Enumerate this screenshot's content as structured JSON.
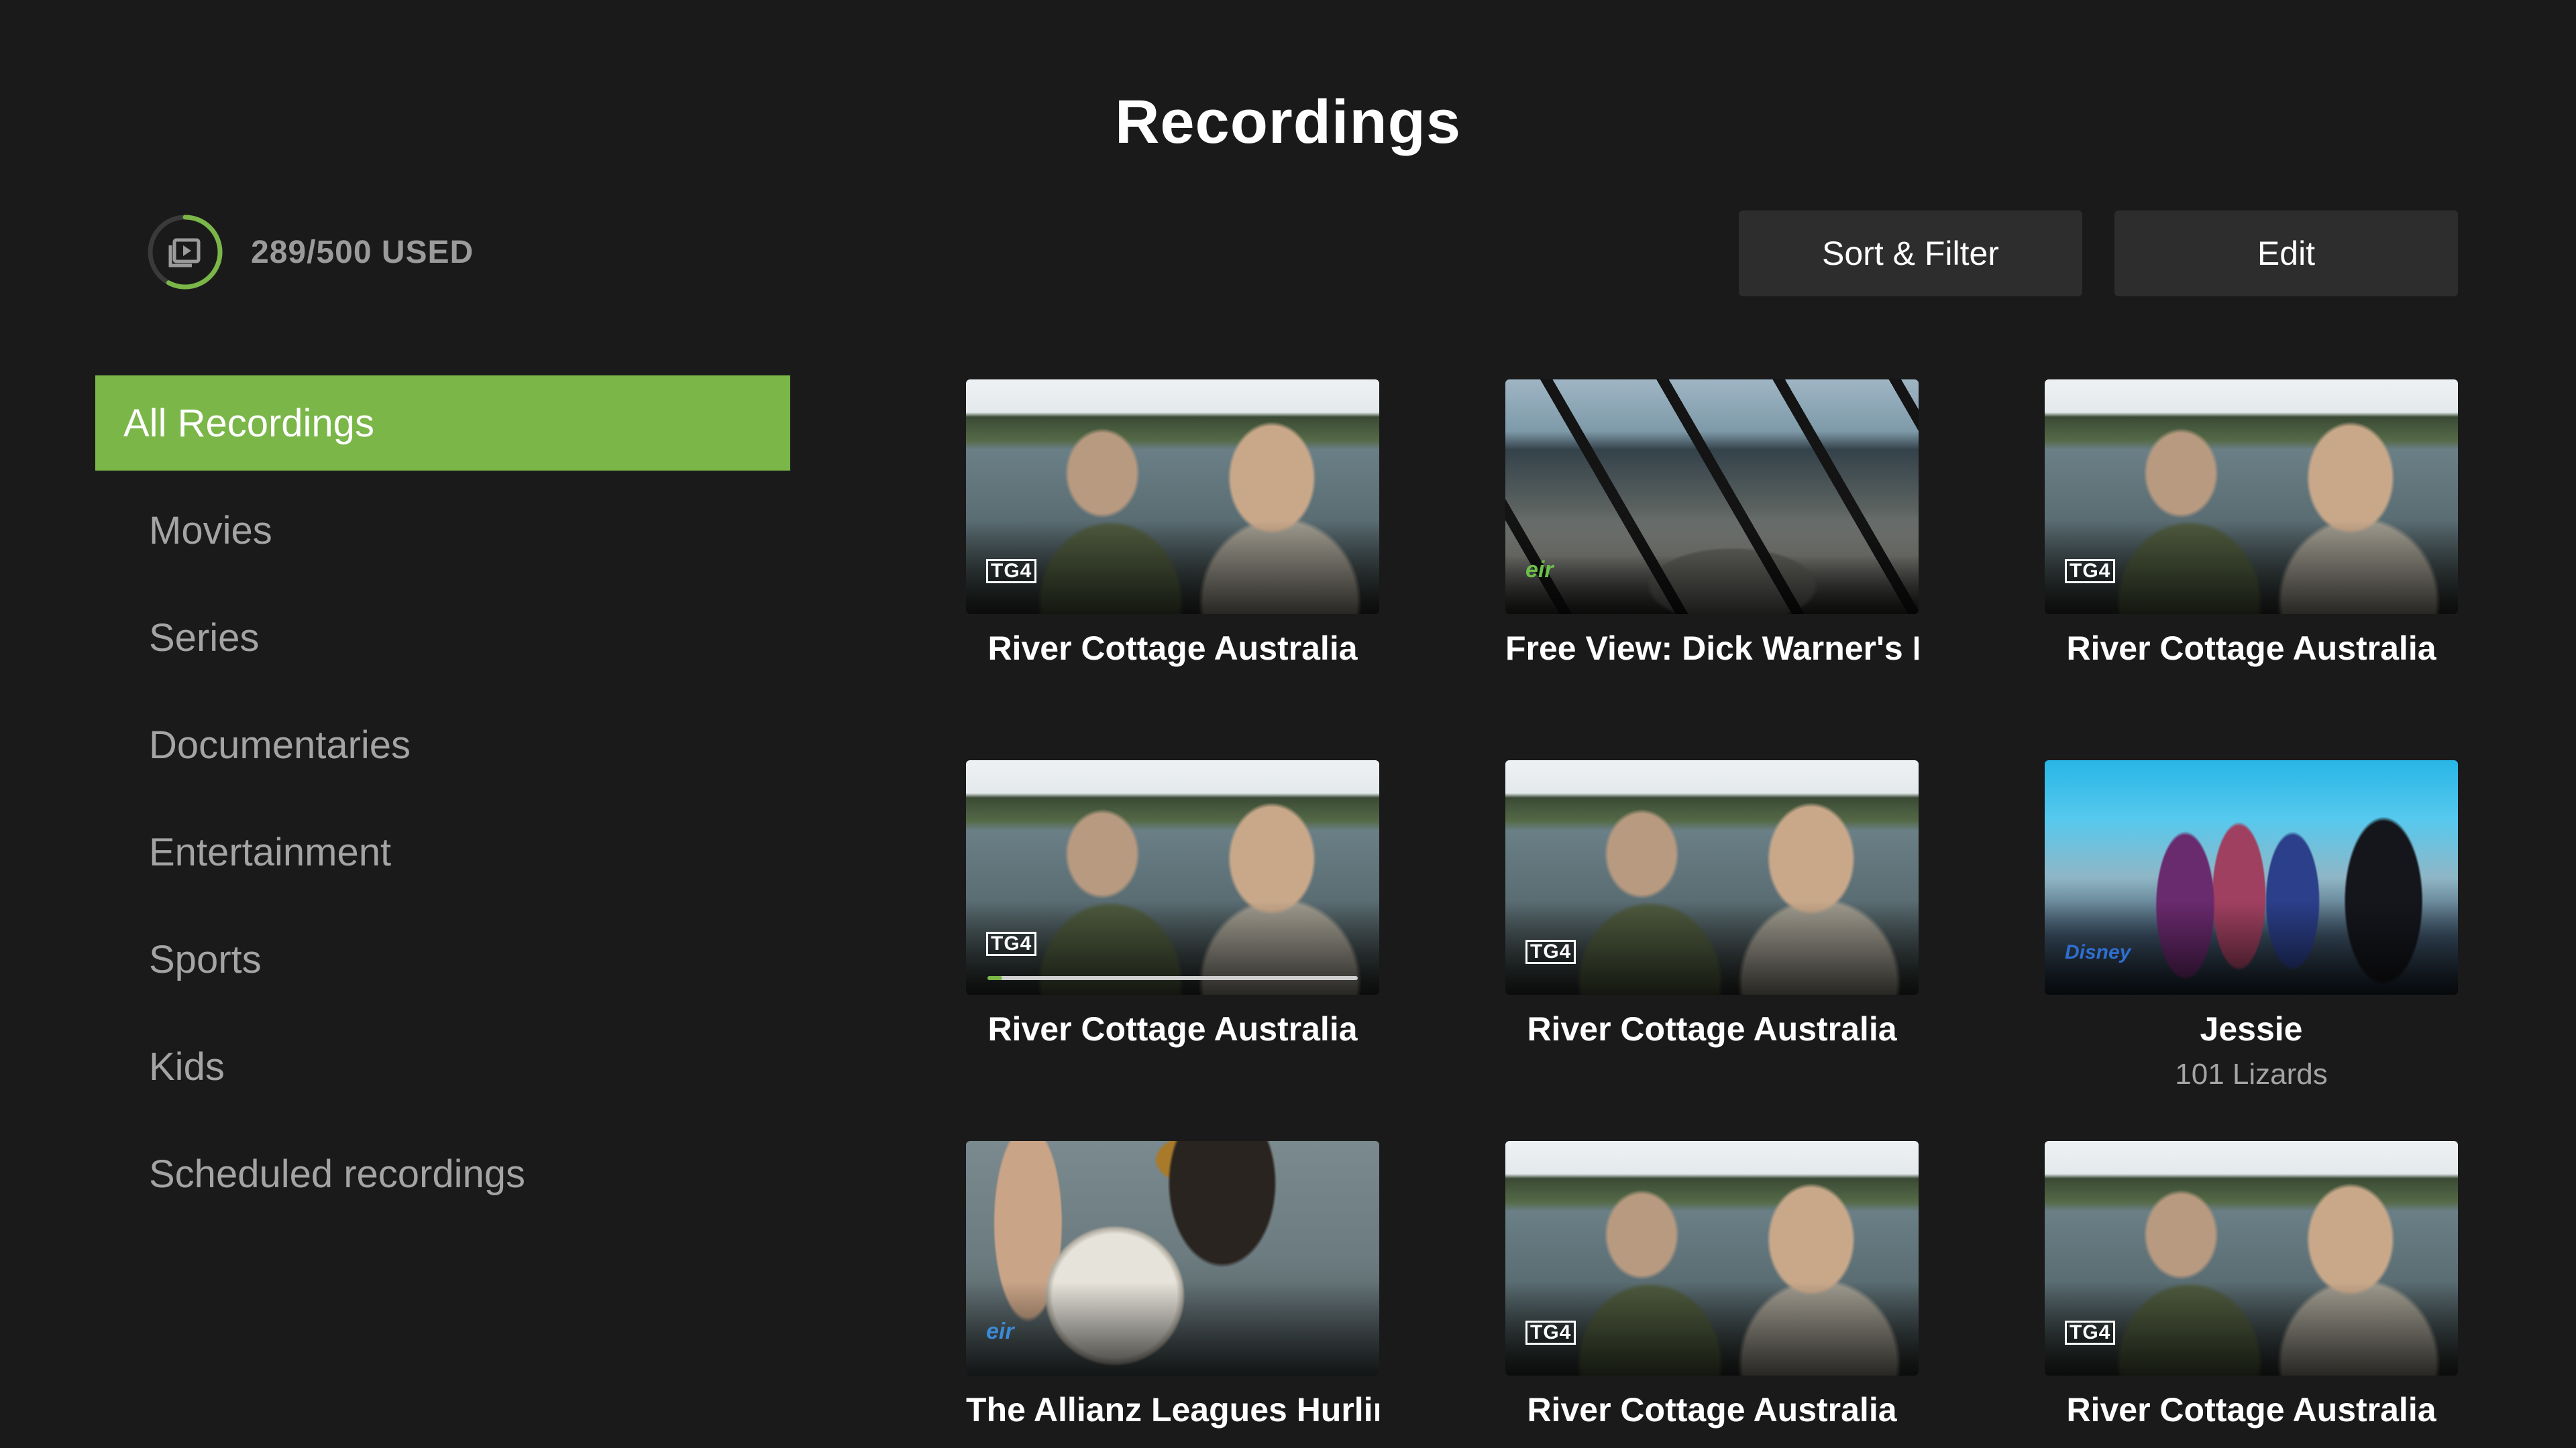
{
  "header": {
    "title": "Recordings"
  },
  "usage": {
    "text": "289/500 USED",
    "used": 289,
    "total": 500
  },
  "toolbar": {
    "sort_filter_label": "Sort & Filter",
    "edit_label": "Edit"
  },
  "sidebar": {
    "items": [
      {
        "label": "All Recordings",
        "active": true
      },
      {
        "label": "Movies"
      },
      {
        "label": "Series"
      },
      {
        "label": "Documentaries"
      },
      {
        "label": "Entertainment"
      },
      {
        "label": "Sports"
      },
      {
        "label": "Kids"
      },
      {
        "label": "Scheduled recordings"
      }
    ]
  },
  "recordings": [
    {
      "title": "River Cottage Australia",
      "channel_logo": "TG4"
    },
    {
      "title": "Free View: Dick Warner's F",
      "channel_logo": "eir"
    },
    {
      "title": "River Cottage Australia",
      "channel_logo": "TG4"
    },
    {
      "title": "River Cottage Australia",
      "channel_logo": "TG4",
      "progress": 0.04
    },
    {
      "title": "River Cottage Australia",
      "channel_logo": "TG4"
    },
    {
      "title": "Jessie",
      "subtitle": "101 Lizards",
      "channel_logo": "Disney"
    },
    {
      "title": "The Allianz Leagues Hurlin",
      "channel_logo": "eir"
    },
    {
      "title": "River Cottage Australia",
      "channel_logo": "TG4"
    },
    {
      "title": "River Cottage Australia",
      "channel_logo": "TG4"
    }
  ],
  "colors": {
    "accent": "#7ab648",
    "background": "#1a1a1a",
    "button": "#2d2d2d",
    "muted_text": "#a4a4a4"
  }
}
